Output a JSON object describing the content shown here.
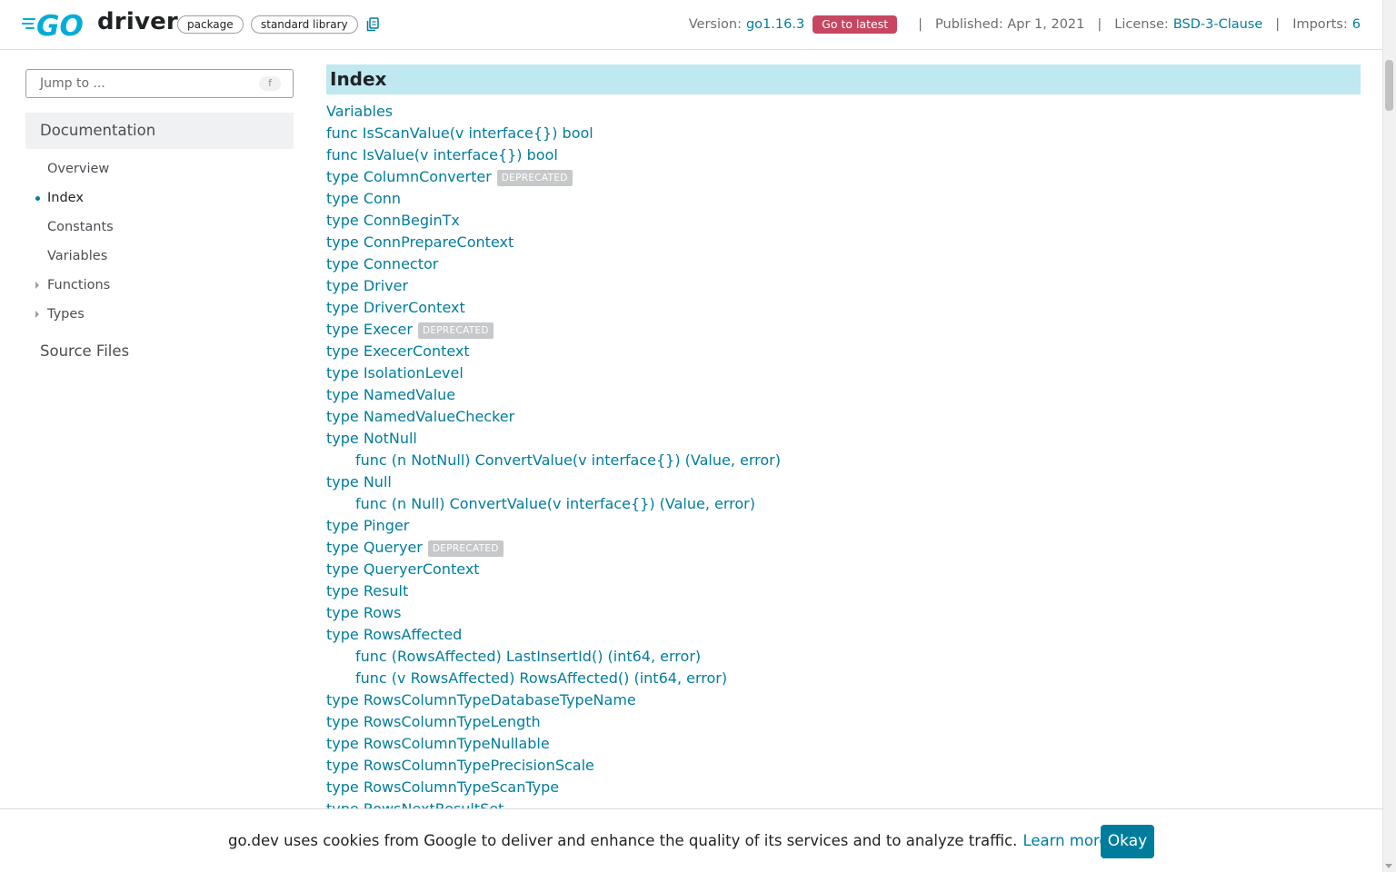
{
  "header": {
    "title": "driver",
    "chips": [
      "package",
      "standard library"
    ],
    "version_label": "Version:",
    "version_value": "go1.16.3",
    "latest_button": "Go to latest",
    "separator": "|",
    "published_label": "Published: Apr 1, 2021",
    "license_label": "License:",
    "license_value": "BSD-3-Clause",
    "imports_label": "Imports:",
    "imports_value": "6"
  },
  "colors": {
    "link": "#007d9c",
    "go_logo": "#00add8",
    "index_bar": "#bfe8f1",
    "latest_badge": "#c84661",
    "deprecated_badge": "#c6c8ca"
  },
  "sidebar": {
    "jump_placeholder": "Jump to ...",
    "jump_shortcut": "f",
    "doc_heading": "Documentation",
    "items": [
      {
        "label": "Overview"
      },
      {
        "label": "Index"
      },
      {
        "label": "Constants"
      },
      {
        "label": "Variables"
      },
      {
        "label": "Functions"
      },
      {
        "label": "Types"
      }
    ],
    "active_item": "Index",
    "source_files": "Source Files"
  },
  "main": {
    "heading": "Index",
    "deprecated_label": "DEPRECATED",
    "items": [
      "Variables",
      "func IsScanValue(v interface{}) bool",
      "func IsValue(v interface{}) bool",
      "type ColumnConverter",
      "type Conn",
      "type ConnBeginTx",
      "type ConnPrepareContext",
      "type Connector",
      "type Driver",
      "type DriverContext",
      "type Execer",
      "type ExecerContext",
      "type IsolationLevel",
      "type NamedValue",
      "type NamedValueChecker",
      "type NotNull",
      "func (n NotNull) ConvertValue(v interface{}) (Value, error)",
      "type Null",
      "func (n Null) ConvertValue(v interface{}) (Value, error)",
      "type Pinger",
      "type Queryer",
      "type QueryerContext",
      "type Result",
      "type Rows",
      "type RowsAffected",
      "func (RowsAffected) LastInsertId() (int64, error)",
      "func (v RowsAffected) RowsAffected() (int64, error)",
      "type RowsColumnTypeDatabaseTypeName",
      "type RowsColumnTypeLength",
      "type RowsColumnTypeNullable",
      "type RowsColumnTypePrecisionScale",
      "type RowsColumnTypeScanType",
      "type RowsNextResultSet"
    ]
  },
  "cookie_banner": {
    "text": "go.dev uses cookies from Google to deliver and enhance the quality of its services and to analyze traffic.",
    "learn_more": "Learn more.",
    "okay": "Okay"
  }
}
